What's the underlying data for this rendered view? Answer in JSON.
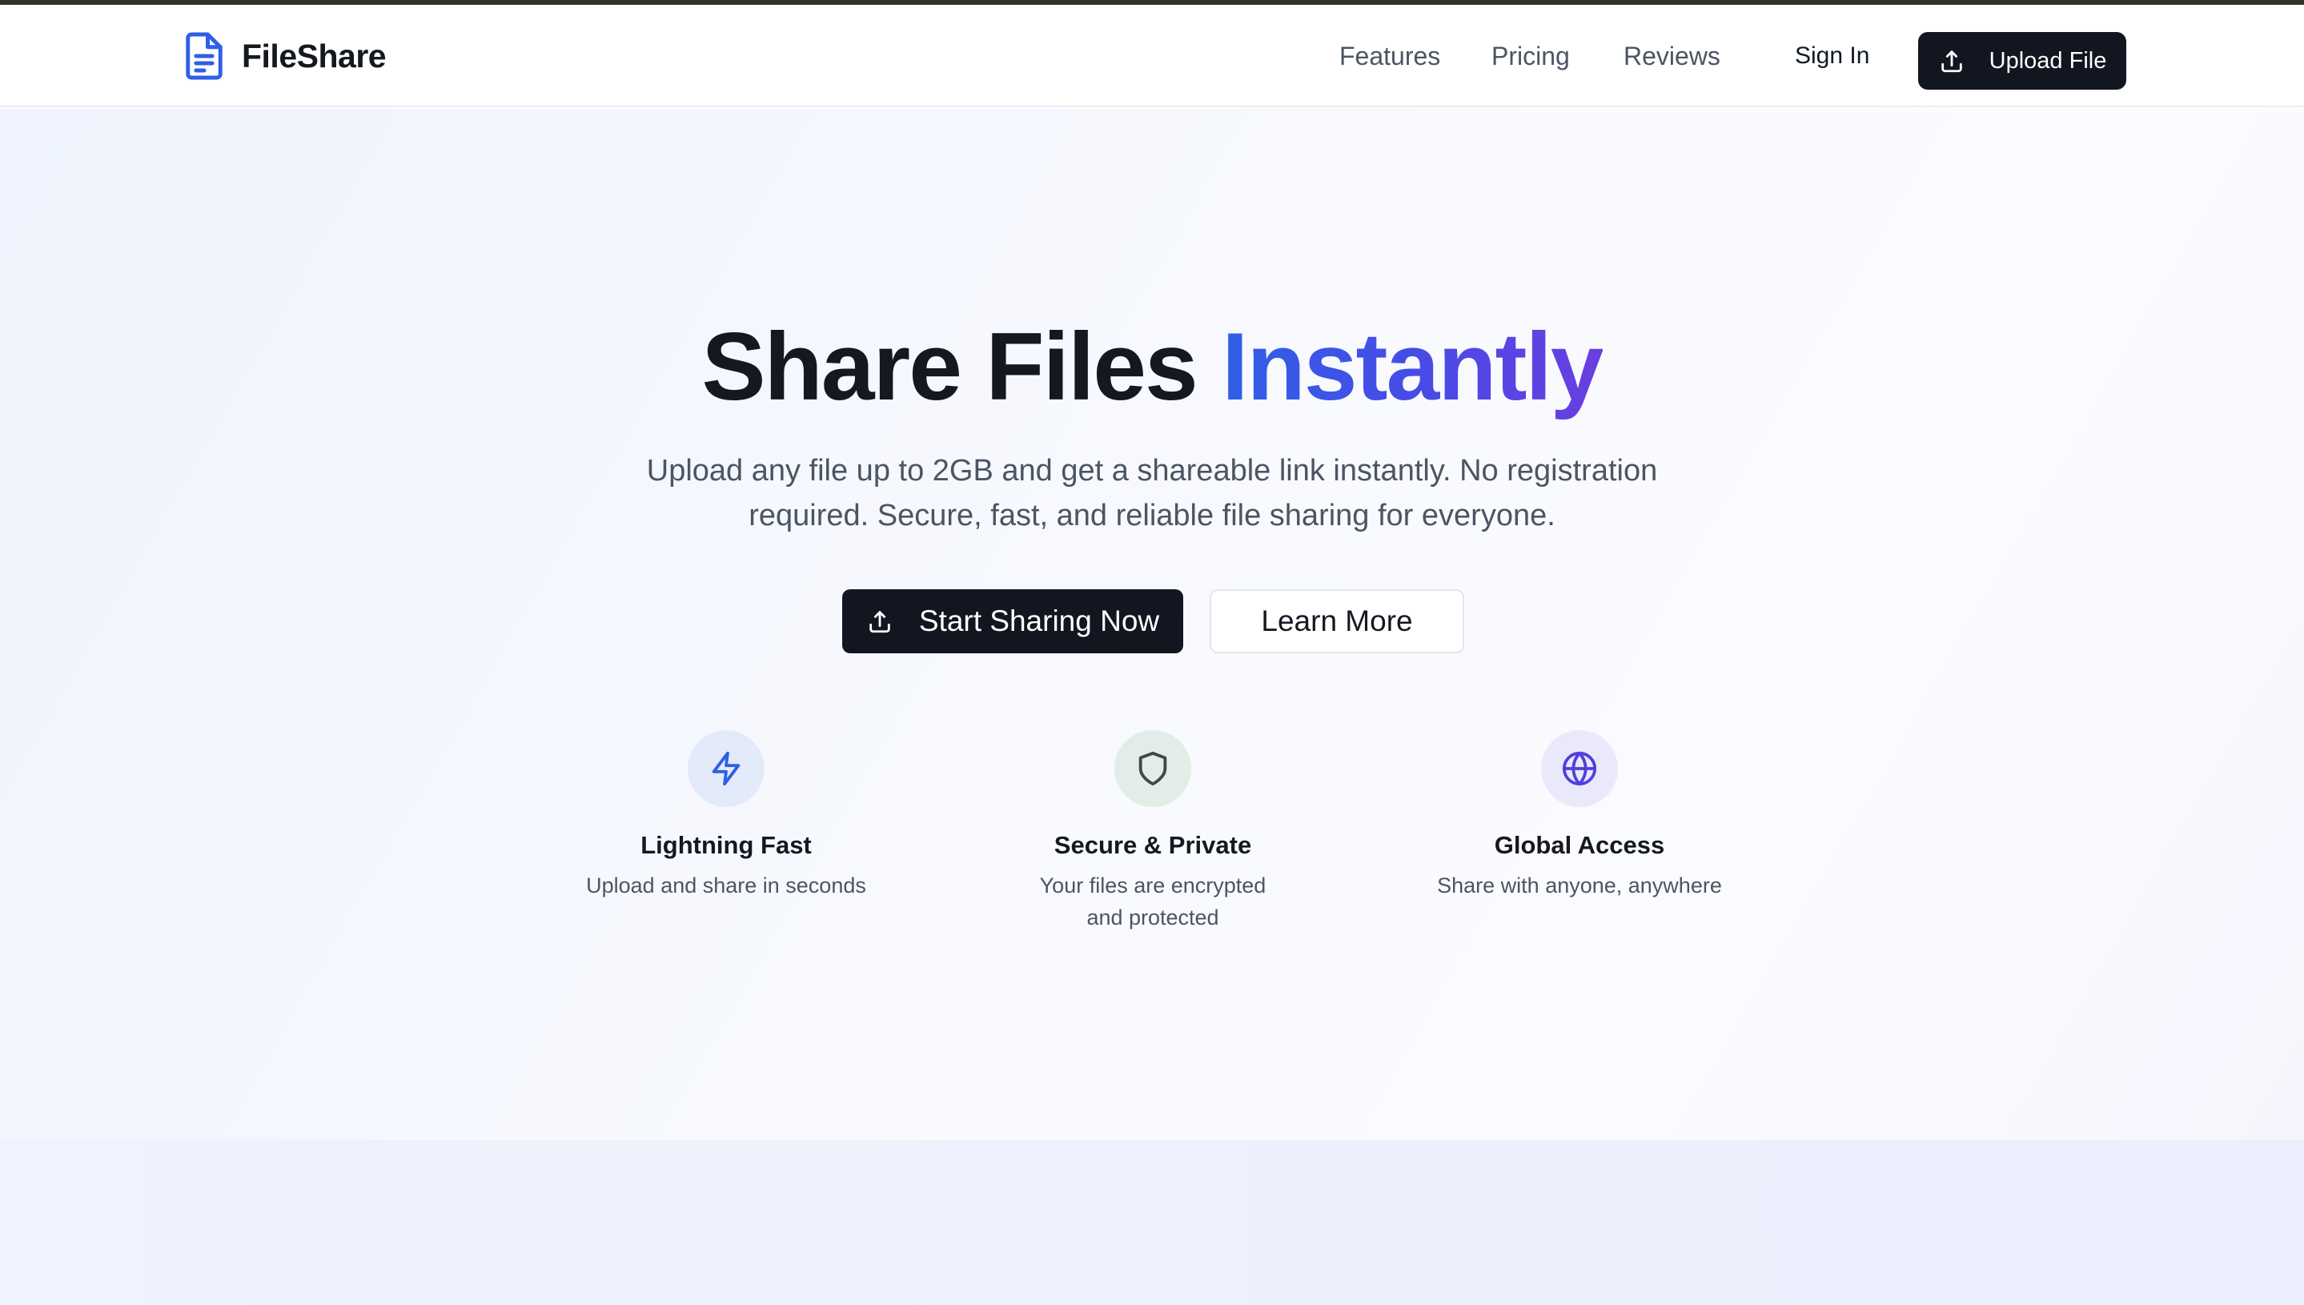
{
  "brand": {
    "name": "FileShare",
    "icon": "file-text-icon",
    "color": "#2f5fe6"
  },
  "nav": {
    "links": [
      {
        "label": "Features"
      },
      {
        "label": "Pricing"
      },
      {
        "label": "Reviews"
      }
    ],
    "sign_in": "Sign In",
    "upload": {
      "label": "Upload File",
      "icon": "upload-icon"
    }
  },
  "hero": {
    "title_main": "Share Files ",
    "title_accent": "Instantly",
    "subtitle": "Upload any file up to 2GB and get a shareable link instantly. No registration required. Secure, fast, and reliable file sharing for everyone.",
    "primary_button": {
      "label": "Start Sharing Now",
      "icon": "upload-icon"
    },
    "secondary_button": {
      "label": "Learn More"
    }
  },
  "features": [
    {
      "title": "Lightning Fast",
      "description": "Upload and share in seconds",
      "icon": "lightning-icon",
      "icon_color": "#2f5fe6",
      "bg_color": "#e3ebfb"
    },
    {
      "title": "Secure & Private",
      "description": "Your files are encrypted and protected",
      "icon": "shield-icon",
      "icon_color": "#3f4a45",
      "bg_color": "#e3ede8"
    },
    {
      "title": "Global Access",
      "description": "Share with anyone, anywhere",
      "icon": "globe-icon",
      "icon_color": "#4f3fe0",
      "bg_color": "#e9e9fb"
    }
  ],
  "colors": {
    "primary_dark": "#121620",
    "accent_gradient_start": "#2f5fe6",
    "accent_gradient_end": "#6a3ee0"
  }
}
